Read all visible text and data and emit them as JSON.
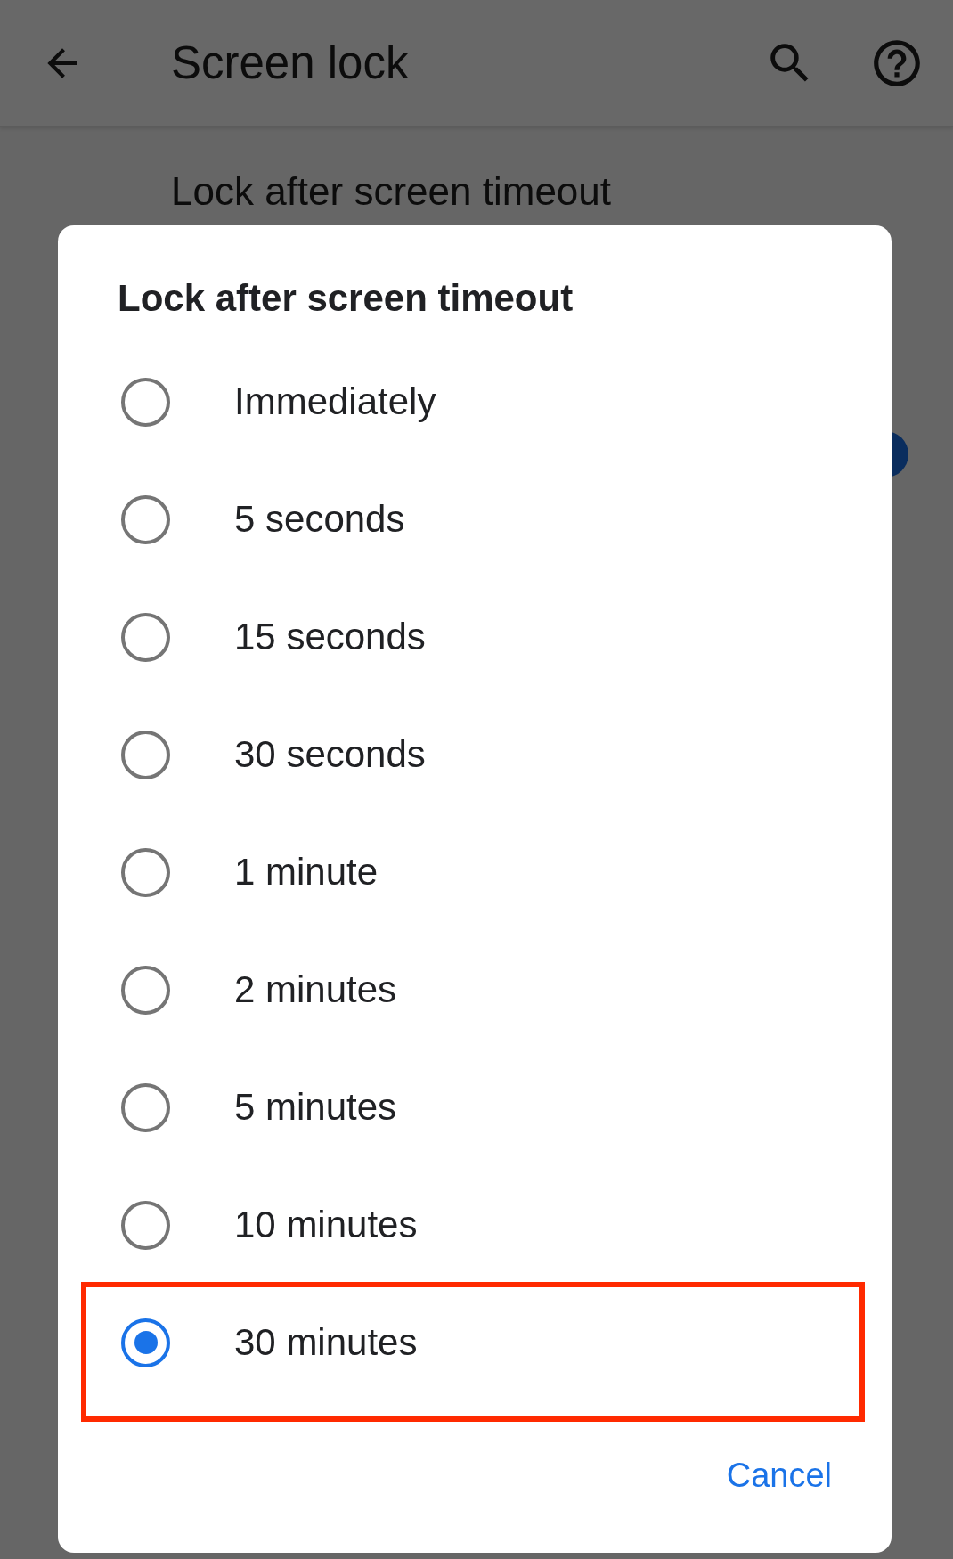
{
  "app_bar": {
    "title": "Screen lock"
  },
  "background_setting": {
    "label": "Lock after screen timeout",
    "switch_on": true
  },
  "dialog": {
    "title": "Lock after screen timeout",
    "options": [
      {
        "label": "Immediately",
        "selected": false,
        "highlighted": false
      },
      {
        "label": "5 seconds",
        "selected": false,
        "highlighted": false
      },
      {
        "label": "15 seconds",
        "selected": false,
        "highlighted": false
      },
      {
        "label": "30 seconds",
        "selected": false,
        "highlighted": false
      },
      {
        "label": "1 minute",
        "selected": false,
        "highlighted": false
      },
      {
        "label": "2 minutes",
        "selected": false,
        "highlighted": false
      },
      {
        "label": "5 minutes",
        "selected": false,
        "highlighted": false
      },
      {
        "label": "10 minutes",
        "selected": false,
        "highlighted": false
      },
      {
        "label": "30 minutes",
        "selected": true,
        "highlighted": true
      }
    ],
    "cancel": "Cancel"
  }
}
